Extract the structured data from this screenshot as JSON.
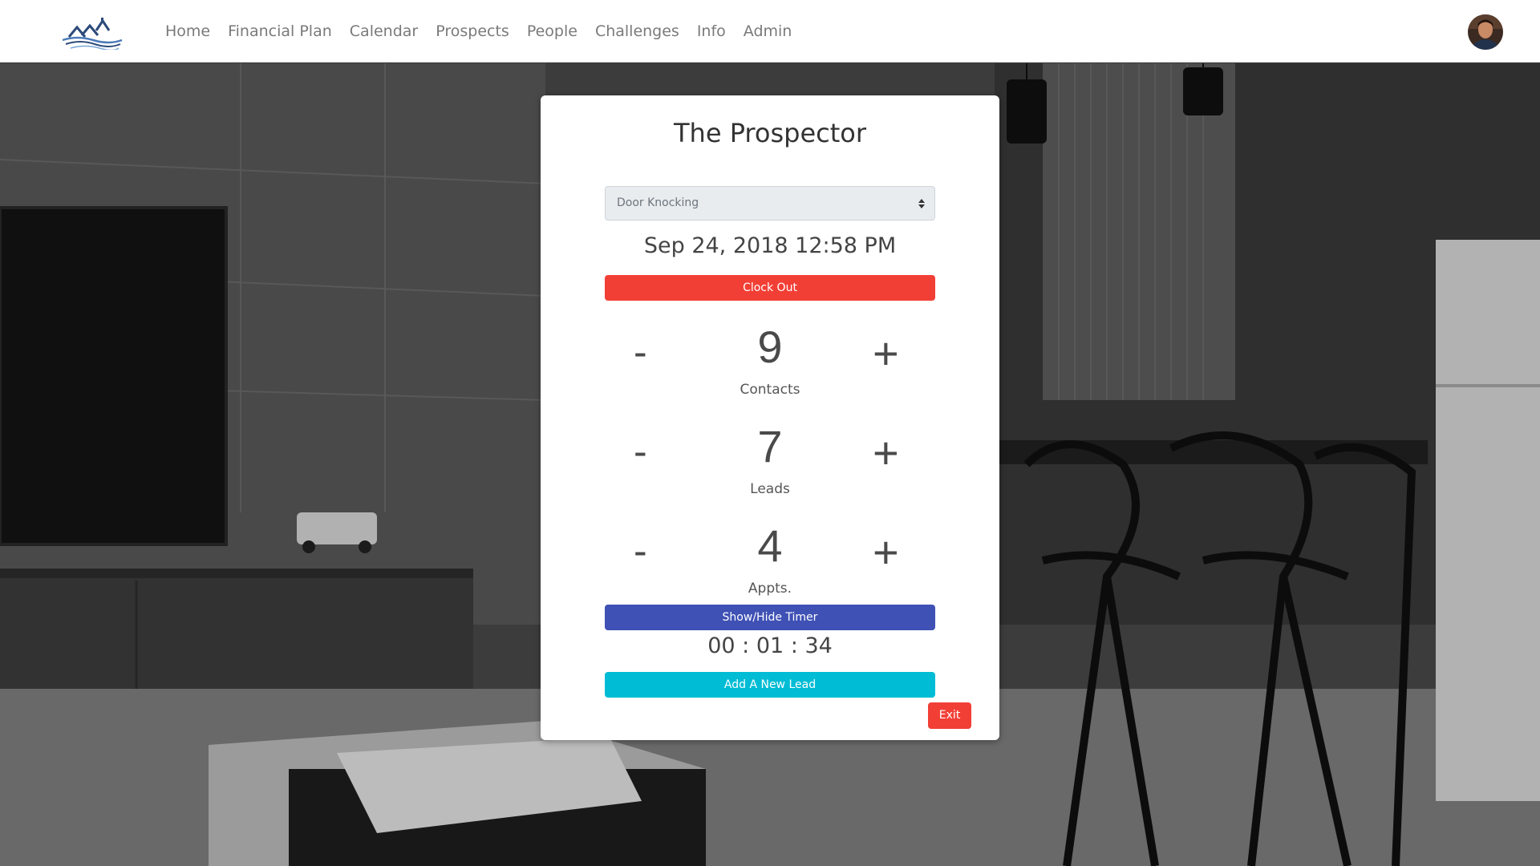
{
  "nav": {
    "items": [
      {
        "label": "Home"
      },
      {
        "label": "Financial Plan"
      },
      {
        "label": "Calendar"
      },
      {
        "label": "Prospects"
      },
      {
        "label": "People"
      },
      {
        "label": "Challenges"
      },
      {
        "label": "Info"
      },
      {
        "label": "Admin"
      }
    ],
    "logo_icon": "houses-waves-logo",
    "avatar_icon": "user-avatar"
  },
  "card": {
    "title": "The Prospector",
    "activity_select": {
      "value": "Door Knocking"
    },
    "datetime": "Sep 24, 2018 12:58 PM",
    "clock_button": "Clock Out",
    "counters": [
      {
        "minus": "-",
        "value": "9",
        "plus": "+",
        "label": "Contacts"
      },
      {
        "minus": "-",
        "value": "7",
        "plus": "+",
        "label": "Leads"
      },
      {
        "minus": "-",
        "value": "4",
        "plus": "+",
        "label": "Appts."
      }
    ],
    "timer_button": "Show/Hide Timer",
    "timer": "00 : 01 : 34",
    "lead_button": "Add A New Lead",
    "exit_button": "Exit"
  },
  "colors": {
    "red": "#f23f36",
    "indigo": "#3f51b5",
    "cyan": "#00bcd4"
  }
}
